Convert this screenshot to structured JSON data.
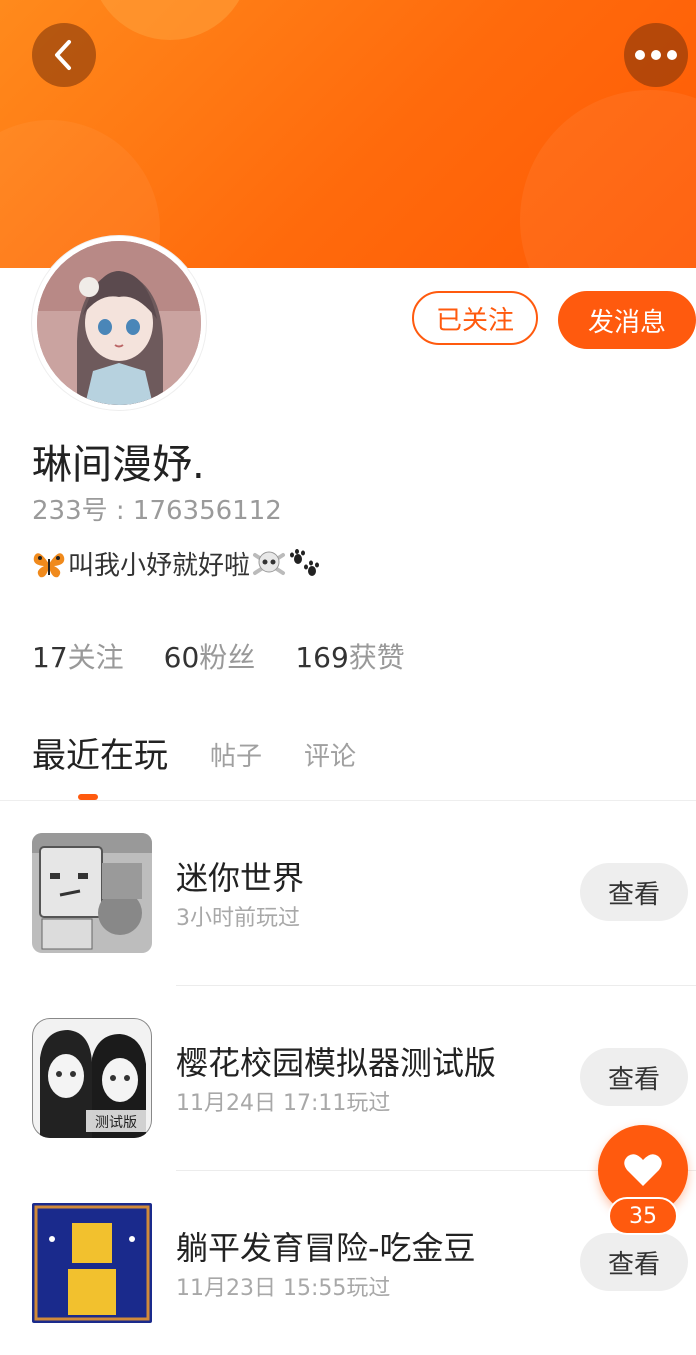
{
  "header": {
    "back_icon": "chevron-left-icon",
    "more_icon": "more-dots-icon",
    "accent_color": "#ff5a0e"
  },
  "profile": {
    "username": "琳间漫妤.",
    "uid": "233号 : 176356112",
    "bio_prefix_icon": "butterfly-emoji",
    "bio_text": "叫我小妤就好啦",
    "bio_suffix_icons": [
      "skull-crossbones-emoji",
      "paw-prints-emoji"
    ],
    "followed_label": "已关注",
    "message_label": "发消息"
  },
  "stats": [
    {
      "value": "17",
      "label": "关注"
    },
    {
      "value": "60",
      "label": "粉丝"
    },
    {
      "value": "169",
      "label": "获赞"
    }
  ],
  "tabs": {
    "active": "最近在玩",
    "items": [
      "帖子",
      "评论"
    ]
  },
  "games": [
    {
      "name": "迷你世界",
      "time": "3小时前玩过",
      "action": "查看"
    },
    {
      "name": "樱花校园模拟器测试版",
      "time": "11月24日 17:11玩过",
      "action": "查看"
    },
    {
      "name": "躺平发育冒险-吃金豆",
      "time": "11月23日 15:55玩过",
      "action": "查看"
    }
  ],
  "like": {
    "icon": "heart-icon",
    "count": "35"
  }
}
